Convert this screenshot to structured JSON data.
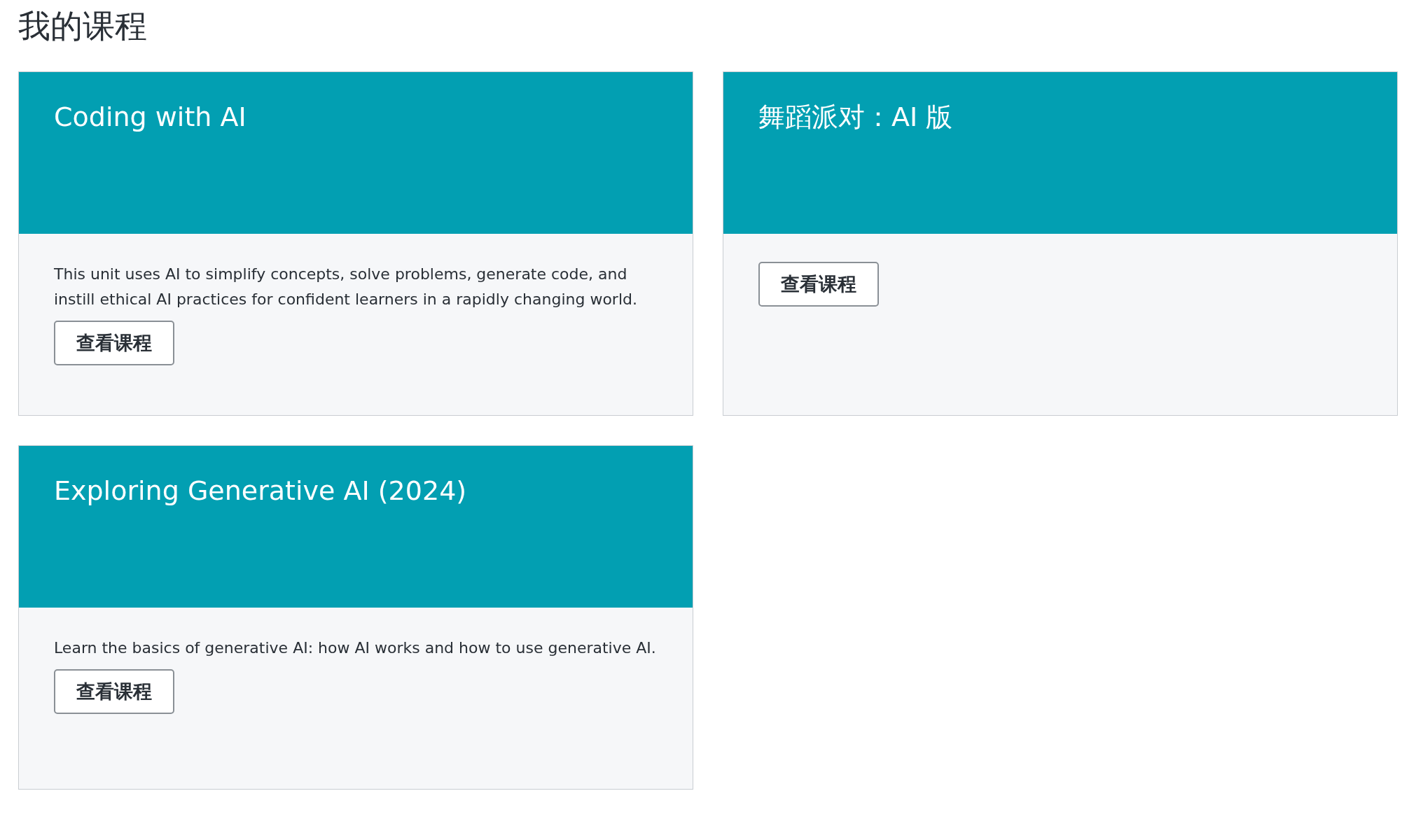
{
  "page_title": "我的课程",
  "courses": [
    {
      "title": "Coding with AI",
      "description": "This unit uses AI to simplify concepts, solve problems, generate code, and instill ethical AI practices for confident learners in a rapidly changing world.",
      "button": "查看课程"
    },
    {
      "title": "舞蹈派对：AI 版",
      "button": "查看课程"
    },
    {
      "title": "Exploring Generative AI (2024)",
      "description": "Learn the basics of generative AI: how AI works and how to use generative AI.",
      "button": "查看课程"
    }
  ]
}
